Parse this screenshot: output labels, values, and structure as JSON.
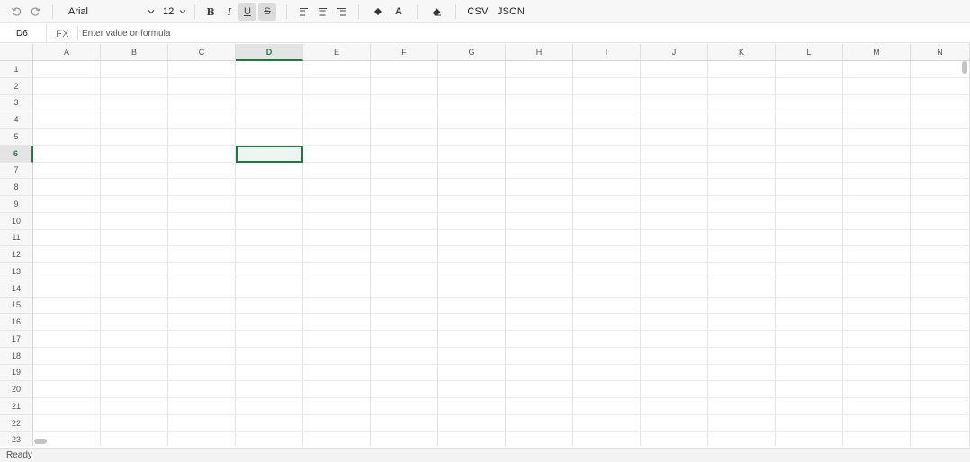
{
  "toolbar": {
    "font_family": "Arial",
    "font_size": "12",
    "bold_label": "B",
    "italic_label": "I",
    "underline_label": "U",
    "strike_label": "S",
    "text_color_label": "A",
    "csv_label": "CSV",
    "json_label": "JSON"
  },
  "formula_bar": {
    "cell_ref": "D6",
    "fx_label": "FX",
    "placeholder": "Enter value or formula",
    "value": ""
  },
  "grid": {
    "columns": [
      "A",
      "B",
      "C",
      "D",
      "E",
      "F",
      "G",
      "H",
      "I",
      "J",
      "K",
      "L",
      "M",
      "N"
    ],
    "rows": [
      "1",
      "2",
      "3",
      "4",
      "5",
      "6",
      "7",
      "8",
      "9",
      "10",
      "11",
      "12",
      "13",
      "14",
      "15",
      "16",
      "17",
      "18",
      "19",
      "20",
      "21",
      "22",
      "23"
    ],
    "active_column": "D",
    "active_row": "6",
    "accent_color": "#1e7a45"
  },
  "status": {
    "text": "Ready"
  }
}
